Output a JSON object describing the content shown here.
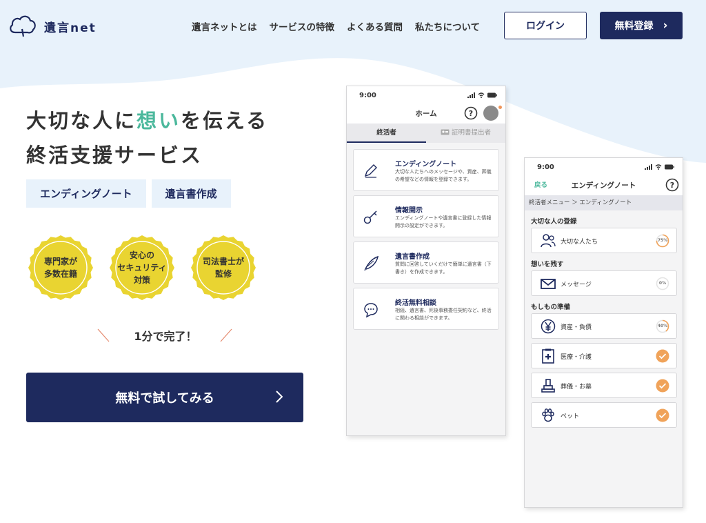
{
  "colors": {
    "navy": "#1e2a5e",
    "accent_green": "#4bb89c",
    "badge_yellow": "#e9d431",
    "check_orange": "#f0a35a",
    "sky": "#e8f2fb"
  },
  "header": {
    "logo_text": "遺言net",
    "nav": [
      "遺言ネットとは",
      "サービスの特徴",
      "よくある質問",
      "私たちについて"
    ],
    "login_label": "ログイン",
    "register_label": "無料登録",
    "register_arrow": "›"
  },
  "hero": {
    "title_line1_pre": "大切な人に",
    "title_line1_accent": "想い",
    "title_line1_post": "を伝える",
    "title_line2": "終活支援サービス",
    "tags": [
      "エンディングノート",
      "遺言書作成"
    ],
    "badges": [
      "専門家が\n多数在籍",
      "安心の\nセキュリティ\n対策",
      "司法書士が\n監修"
    ],
    "minute_text": "1分で完了！",
    "cta_label": "無料で試してみる",
    "cta_arrow": "›"
  },
  "phone1": {
    "time": "9:00",
    "title": "ホーム",
    "tabs": [
      "終活者",
      "証明書提出者"
    ],
    "cards": [
      {
        "title": "エンディングノート",
        "desc": "大切な人たちへのメッセージや、資産、葬儀の希望などの情報を登録できます。",
        "icon": "pen-icon"
      },
      {
        "title": "情報開示",
        "desc": "エンディングノートや遺言書に登録した情報開示の設定ができます。",
        "icon": "key-icon"
      },
      {
        "title": "遺言書作成",
        "desc": "質問に回答していくだけで簡単に遺言書（下書き）を作成できます。",
        "icon": "quill-icon"
      },
      {
        "title": "終活無料相談",
        "desc": "相続、遺言書、死後事務委任契約など、終活に関わる相談ができます。",
        "icon": "chat-icon"
      }
    ]
  },
  "phone2": {
    "time": "9:00",
    "back": "戻る",
    "title": "エンディングノート",
    "breadcrumb": "終活者メニュー ＞ エンディングノート",
    "sections": [
      {
        "title": "大切な人の登録",
        "items": [
          {
            "label": "大切な人たち",
            "progress": "75%",
            "icon": "people-icon"
          }
        ]
      },
      {
        "title": "想いを残す",
        "items": [
          {
            "label": "メッセージ",
            "progress": "0%",
            "icon": "mail-icon"
          }
        ]
      },
      {
        "title": "もしもの準備",
        "items": [
          {
            "label": "資産・負債",
            "progress": "40%",
            "icon": "yen-icon"
          },
          {
            "label": "医療・介護",
            "progress": "done",
            "icon": "medical-icon"
          },
          {
            "label": "葬儀・お墓",
            "progress": "done",
            "icon": "grave-icon"
          },
          {
            "label": "ペット",
            "progress": "done",
            "icon": "paw-icon"
          }
        ]
      }
    ]
  }
}
